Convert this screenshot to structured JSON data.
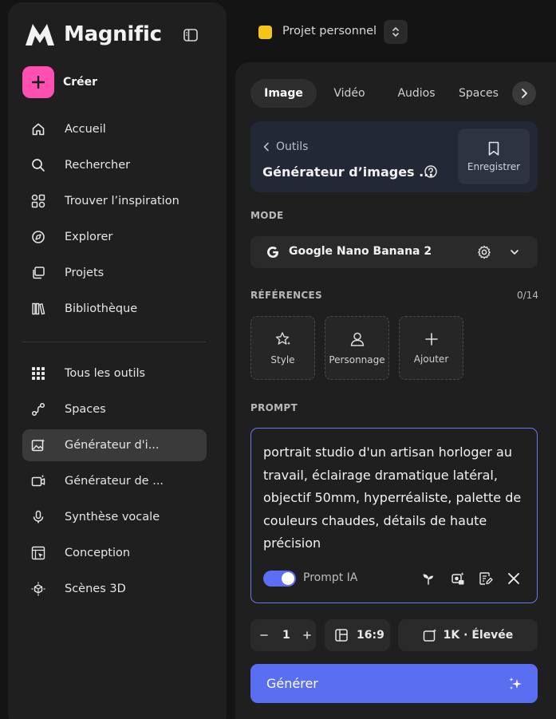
{
  "app": {
    "name": "Magnific"
  },
  "sidebar": {
    "create_label": "Créer",
    "nav_top": [
      {
        "label": "Accueil",
        "icon": "home-icon"
      },
      {
        "label": "Rechercher",
        "icon": "search-icon"
      },
      {
        "label": "Trouver l’inspiration",
        "icon": "inspiration-icon"
      },
      {
        "label": "Explorer",
        "icon": "explore-icon"
      },
      {
        "label": "Projets",
        "icon": "projects-icon"
      },
      {
        "label": "Bibliothèque",
        "icon": "library-icon"
      }
    ],
    "nav_tools": [
      {
        "label": "Tous les outils",
        "icon": "grid-icon"
      },
      {
        "label": "Spaces",
        "icon": "spaces-icon"
      },
      {
        "label": "Générateur d'i...",
        "icon": "image-generator-icon",
        "active": true
      },
      {
        "label": "Générateur de ...",
        "icon": "video-generator-icon"
      },
      {
        "label": "Synthèse vocale",
        "icon": "microphone-icon"
      },
      {
        "label": "Conception",
        "icon": "design-icon"
      },
      {
        "label": "Scènes 3D",
        "icon": "cube-3d-icon"
      }
    ]
  },
  "project": {
    "name": "Projet personnel",
    "color": "#f5c518"
  },
  "tabs": [
    "Image",
    "Vidéo",
    "Audios",
    "Spaces"
  ],
  "tool": {
    "back_label": "Outils",
    "title": "Générateur d’images ...",
    "save_label": "Enregistrer"
  },
  "mode": {
    "label": "MODE",
    "model_name": "Google Nano Banana 2"
  },
  "references": {
    "label": "RÉFÉRENCES",
    "count": "0/14",
    "items": [
      "Style",
      "Personnage",
      "Ajouter"
    ]
  },
  "prompt": {
    "label": "PROMPT",
    "text": "portrait studio d'un artisan horloger au travail, éclairage dramatique latéral, objectif 50mm, hyperréaliste, palette de couleurs chaudes, détails de haute précision",
    "ai_toggle_label": "Prompt IA",
    "ai_toggle_on": true
  },
  "controls": {
    "quantity": "1",
    "aspect_ratio": "16:9",
    "quality": "1K · Élevée"
  },
  "generate": {
    "label": "Générer"
  },
  "colors": {
    "accent": "#5a6ef2",
    "create_button": "#ff4fb0",
    "project_dot": "#f5c518"
  }
}
